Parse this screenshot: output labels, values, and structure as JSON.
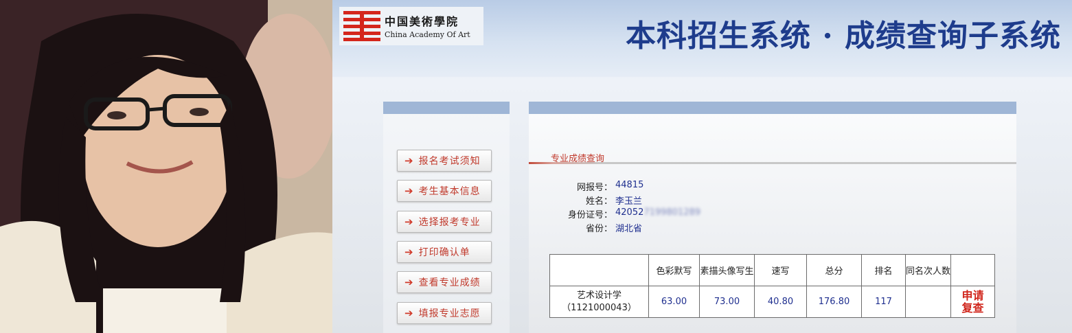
{
  "logo": {
    "chinese": "中国美術學院",
    "english": "China Academy Of Art",
    "icon": "logo-mark-icon"
  },
  "system_title": "本科招生系统 · 成绩查询子系统",
  "nav": {
    "items": [
      {
        "label": "报名考试须知",
        "icon": "arrow-right-icon"
      },
      {
        "label": "考生基本信息",
        "icon": "arrow-right-icon"
      },
      {
        "label": "选择报考专业",
        "icon": "arrow-right-icon"
      },
      {
        "label": "打印确认单",
        "icon": "arrow-right-icon"
      },
      {
        "label": "查看专业成绩",
        "icon": "arrow-right-icon"
      },
      {
        "label": "填报专业志愿",
        "icon": "arrow-right-icon"
      }
    ]
  },
  "section_title": "专业成绩查询",
  "candidate": {
    "registration_no_label": "网报号：",
    "registration_no": "44815",
    "name_label": "姓名：",
    "name": "李玉兰",
    "id_label": "身份证号：",
    "id_value": "42052",
    "province_label": "省份：",
    "province": "湖北省"
  },
  "table": {
    "headers": [
      "",
      "色彩默写",
      "素描头像写生",
      "速写",
      "总分",
      "排名",
      "同名次人数",
      ""
    ],
    "row": {
      "major": "艺术设计学",
      "major_code": "（1121000043）",
      "color": "63.00",
      "sketch": "73.00",
      "quick_sketch": "40.80",
      "total": "176.80",
      "rank": "117",
      "same_rank": "",
      "appeal_line1": "申请",
      "appeal_line2": "复查"
    }
  },
  "colors": {
    "title": "#1e3c8c",
    "nav_text": "#c0392b",
    "value_text": "#1f2f8f",
    "appeal": "#d0251b",
    "panel_bar": "#9fb6d6"
  }
}
